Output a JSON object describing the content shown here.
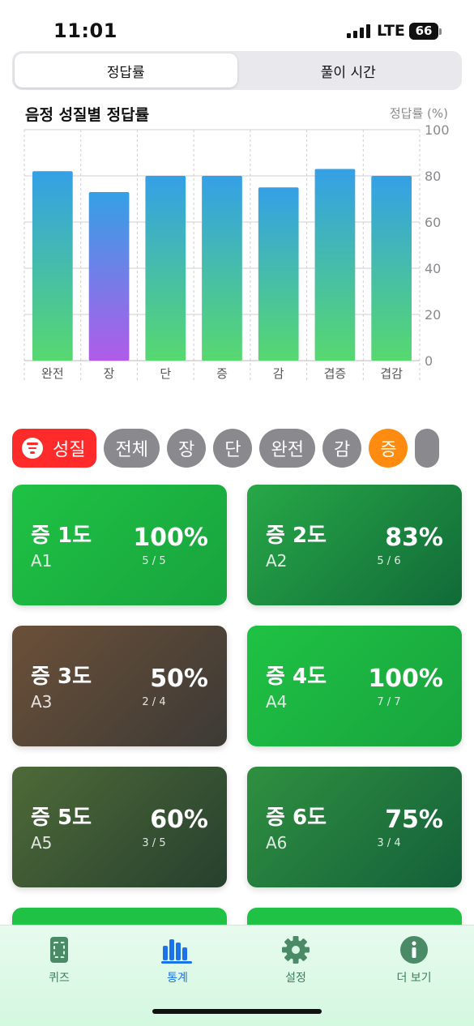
{
  "status_bar": {
    "time": "11:01",
    "network": "LTE",
    "battery": "66"
  },
  "segmented": {
    "tabs": [
      "정답률",
      "풀이 시간"
    ],
    "selected": 0
  },
  "chart": {
    "title": "음정 성질별 정답률",
    "unit_label": "정답률 (%)"
  },
  "chart_data": {
    "type": "bar",
    "title": "음정 성질별 정답률",
    "ylabel": "정답률 (%)",
    "xlabel": "",
    "categories": [
      "완전",
      "장",
      "단",
      "증",
      "감",
      "겹증",
      "겹감"
    ],
    "values": [
      82,
      73,
      80,
      80,
      75,
      83,
      80
    ],
    "ylim": [
      0,
      100
    ],
    "yticks": [
      "0",
      "20",
      "40",
      "60",
      "80",
      "100"
    ],
    "grid": true,
    "colors": {
      "top": "#34a0e6",
      "bottom": "#57d870",
      "highlight_bottom": "#b05ce8"
    },
    "highlight_category": "장"
  },
  "filters": {
    "main_label": "성질",
    "chips": [
      "전체",
      "장",
      "단",
      "완전",
      "감",
      "증"
    ],
    "selected": "증"
  },
  "cards": [
    {
      "name": "증 1도",
      "code": "A1",
      "percent": "100%",
      "fraction": "5 / 5",
      "colors": [
        "#1fc244",
        "#18a33e"
      ]
    },
    {
      "name": "증 2도",
      "code": "A2",
      "percent": "83%",
      "fraction": "5 / 6",
      "colors": [
        "#27a847",
        "#116a38"
      ]
    },
    {
      "name": "증 3도",
      "code": "A3",
      "percent": "50%",
      "fraction": "2 / 4",
      "colors": [
        "#6b5038",
        "#3c3a36"
      ]
    },
    {
      "name": "증 4도",
      "code": "A4",
      "percent": "100%",
      "fraction": "7 / 7",
      "colors": [
        "#1fc244",
        "#18a33e"
      ]
    },
    {
      "name": "증 5도",
      "code": "A5",
      "percent": "60%",
      "fraction": "3 / 5",
      "colors": [
        "#4e6a38",
        "#26402e"
      ]
    },
    {
      "name": "증 6도",
      "code": "A6",
      "percent": "75%",
      "fraction": "3 / 4",
      "colors": [
        "#2f9040",
        "#14603a"
      ]
    }
  ],
  "tabbar": {
    "items": [
      {
        "label": "퀴즈",
        "icon": "quiz-card-icon"
      },
      {
        "label": "통계",
        "icon": "bar-chart-icon"
      },
      {
        "label": "설정",
        "icon": "gear-icon"
      },
      {
        "label": "더 보기",
        "icon": "info-icon"
      }
    ],
    "selected": 1
  }
}
